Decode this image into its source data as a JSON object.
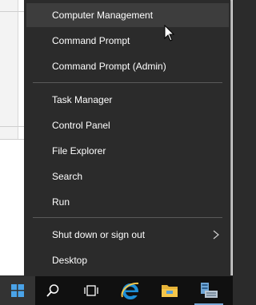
{
  "context_menu": {
    "items": [
      {
        "label": "Computer Management"
      },
      {
        "label": "Command Prompt"
      },
      {
        "label": "Command Prompt (Admin)"
      },
      {
        "label": "Task Manager"
      },
      {
        "label": "Control Panel"
      },
      {
        "label": "File Explorer"
      },
      {
        "label": "Search"
      },
      {
        "label": "Run"
      },
      {
        "label": "Shut down or sign out"
      },
      {
        "label": "Desktop"
      }
    ],
    "hovered_item": "Computer Management"
  },
  "taskbar": {
    "icons": [
      "windows-start-icon",
      "search-icon",
      "task-view-icon",
      "internet-explorer-icon",
      "file-explorer-icon",
      "server-manager-icon"
    ]
  },
  "colors": {
    "menu_bg": "#2b2b2b",
    "hover_bg": "#3d3d3d",
    "separator": "#5a5a5a",
    "taskbar_bg": "#101010",
    "start_blue": "#4aa3e8",
    "ie_blue": "#1e8fd6",
    "folder_yellow": "#f5c64a"
  }
}
